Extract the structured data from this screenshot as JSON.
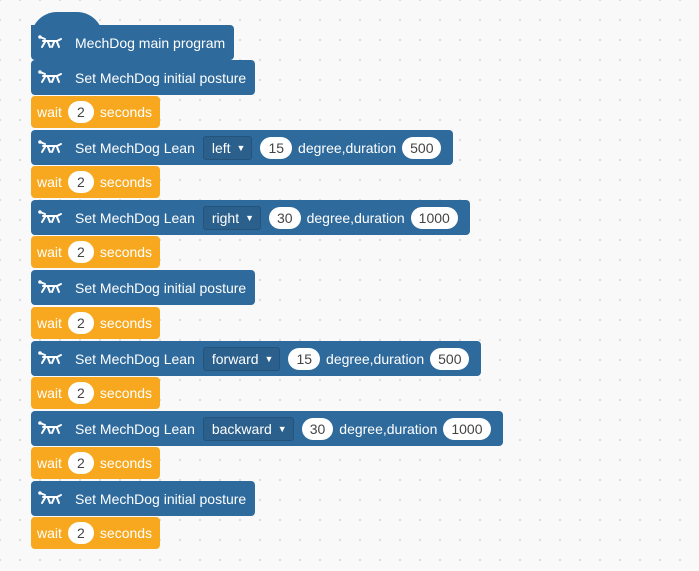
{
  "colors": {
    "motion_block": "#2e6a9c",
    "control_block": "#f7a81e",
    "canvas": "#f9f9f9"
  },
  "blocks": [
    {
      "type": "hat",
      "icon": "mechdog-icon",
      "label": "MechDog main program"
    },
    {
      "type": "posture",
      "icon": "mechdog-icon",
      "label": "Set MechDog initial posture"
    },
    {
      "type": "wait",
      "label": "wait",
      "value": "2",
      "unit": "seconds"
    },
    {
      "type": "lean",
      "icon": "mechdog-icon",
      "label": "Set MechDog Lean",
      "direction": "left",
      "angle": "15",
      "mid": "degree,duration",
      "duration": "500"
    },
    {
      "type": "wait",
      "label": "wait",
      "value": "2",
      "unit": "seconds"
    },
    {
      "type": "lean",
      "icon": "mechdog-icon",
      "label": "Set MechDog Lean",
      "direction": "right",
      "angle": "30",
      "mid": "degree,duration",
      "duration": "1000"
    },
    {
      "type": "wait",
      "label": "wait",
      "value": "2",
      "unit": "seconds"
    },
    {
      "type": "posture",
      "icon": "mechdog-icon",
      "label": "Set MechDog initial posture"
    },
    {
      "type": "wait",
      "label": "wait",
      "value": "2",
      "unit": "seconds"
    },
    {
      "type": "lean",
      "icon": "mechdog-icon",
      "label": "Set MechDog Lean",
      "direction": "forward",
      "angle": "15",
      "mid": "degree,duration",
      "duration": "500"
    },
    {
      "type": "wait",
      "label": "wait",
      "value": "2",
      "unit": "seconds"
    },
    {
      "type": "lean",
      "icon": "mechdog-icon",
      "label": "Set MechDog Lean",
      "direction": "backward",
      "angle": "30",
      "mid": "degree,duration",
      "duration": "1000"
    },
    {
      "type": "wait",
      "label": "wait",
      "value": "2",
      "unit": "seconds"
    },
    {
      "type": "posture",
      "icon": "mechdog-icon",
      "label": "Set MechDog initial posture"
    },
    {
      "type": "wait",
      "label": "wait",
      "value": "2",
      "unit": "seconds"
    }
  ]
}
